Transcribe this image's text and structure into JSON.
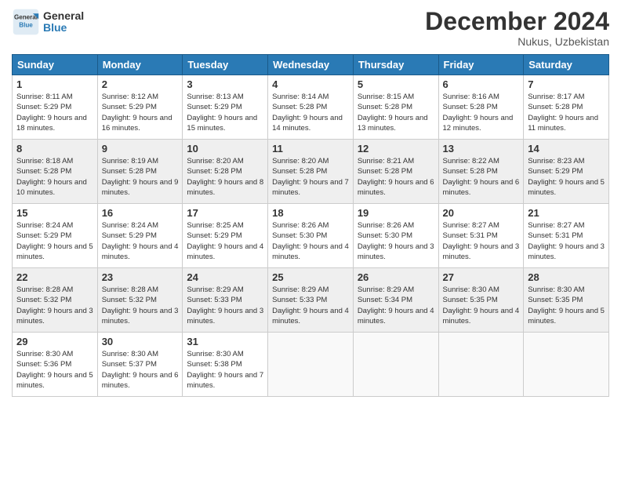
{
  "logo": {
    "general": "General",
    "blue": "Blue"
  },
  "title": "December 2024",
  "subtitle": "Nukus, Uzbekistan",
  "headers": [
    "Sunday",
    "Monday",
    "Tuesday",
    "Wednesday",
    "Thursday",
    "Friday",
    "Saturday"
  ],
  "weeks": [
    [
      {
        "day": "1",
        "sunrise": "8:11 AM",
        "sunset": "5:29 PM",
        "daylight": "9 hours and 18 minutes."
      },
      {
        "day": "2",
        "sunrise": "8:12 AM",
        "sunset": "5:29 PM",
        "daylight": "9 hours and 16 minutes."
      },
      {
        "day": "3",
        "sunrise": "8:13 AM",
        "sunset": "5:29 PM",
        "daylight": "9 hours and 15 minutes."
      },
      {
        "day": "4",
        "sunrise": "8:14 AM",
        "sunset": "5:28 PM",
        "daylight": "9 hours and 14 minutes."
      },
      {
        "day": "5",
        "sunrise": "8:15 AM",
        "sunset": "5:28 PM",
        "daylight": "9 hours and 13 minutes."
      },
      {
        "day": "6",
        "sunrise": "8:16 AM",
        "sunset": "5:28 PM",
        "daylight": "9 hours and 12 minutes."
      },
      {
        "day": "7",
        "sunrise": "8:17 AM",
        "sunset": "5:28 PM",
        "daylight": "9 hours and 11 minutes."
      }
    ],
    [
      {
        "day": "8",
        "sunrise": "8:18 AM",
        "sunset": "5:28 PM",
        "daylight": "9 hours and 10 minutes."
      },
      {
        "day": "9",
        "sunrise": "8:19 AM",
        "sunset": "5:28 PM",
        "daylight": "9 hours and 9 minutes."
      },
      {
        "day": "10",
        "sunrise": "8:20 AM",
        "sunset": "5:28 PM",
        "daylight": "9 hours and 8 minutes."
      },
      {
        "day": "11",
        "sunrise": "8:20 AM",
        "sunset": "5:28 PM",
        "daylight": "9 hours and 7 minutes."
      },
      {
        "day": "12",
        "sunrise": "8:21 AM",
        "sunset": "5:28 PM",
        "daylight": "9 hours and 6 minutes."
      },
      {
        "day": "13",
        "sunrise": "8:22 AM",
        "sunset": "5:28 PM",
        "daylight": "9 hours and 6 minutes."
      },
      {
        "day": "14",
        "sunrise": "8:23 AM",
        "sunset": "5:29 PM",
        "daylight": "9 hours and 5 minutes."
      }
    ],
    [
      {
        "day": "15",
        "sunrise": "8:24 AM",
        "sunset": "5:29 PM",
        "daylight": "9 hours and 5 minutes."
      },
      {
        "day": "16",
        "sunrise": "8:24 AM",
        "sunset": "5:29 PM",
        "daylight": "9 hours and 4 minutes."
      },
      {
        "day": "17",
        "sunrise": "8:25 AM",
        "sunset": "5:29 PM",
        "daylight": "9 hours and 4 minutes."
      },
      {
        "day": "18",
        "sunrise": "8:26 AM",
        "sunset": "5:30 PM",
        "daylight": "9 hours and 4 minutes."
      },
      {
        "day": "19",
        "sunrise": "8:26 AM",
        "sunset": "5:30 PM",
        "daylight": "9 hours and 3 minutes."
      },
      {
        "day": "20",
        "sunrise": "8:27 AM",
        "sunset": "5:31 PM",
        "daylight": "9 hours and 3 minutes."
      },
      {
        "day": "21",
        "sunrise": "8:27 AM",
        "sunset": "5:31 PM",
        "daylight": "9 hours and 3 minutes."
      }
    ],
    [
      {
        "day": "22",
        "sunrise": "8:28 AM",
        "sunset": "5:32 PM",
        "daylight": "9 hours and 3 minutes."
      },
      {
        "day": "23",
        "sunrise": "8:28 AM",
        "sunset": "5:32 PM",
        "daylight": "9 hours and 3 minutes."
      },
      {
        "day": "24",
        "sunrise": "8:29 AM",
        "sunset": "5:33 PM",
        "daylight": "9 hours and 3 minutes."
      },
      {
        "day": "25",
        "sunrise": "8:29 AM",
        "sunset": "5:33 PM",
        "daylight": "9 hours and 4 minutes."
      },
      {
        "day": "26",
        "sunrise": "8:29 AM",
        "sunset": "5:34 PM",
        "daylight": "9 hours and 4 minutes."
      },
      {
        "day": "27",
        "sunrise": "8:30 AM",
        "sunset": "5:35 PM",
        "daylight": "9 hours and 4 minutes."
      },
      {
        "day": "28",
        "sunrise": "8:30 AM",
        "sunset": "5:35 PM",
        "daylight": "9 hours and 5 minutes."
      }
    ],
    [
      {
        "day": "29",
        "sunrise": "8:30 AM",
        "sunset": "5:36 PM",
        "daylight": "9 hours and 5 minutes."
      },
      {
        "day": "30",
        "sunrise": "8:30 AM",
        "sunset": "5:37 PM",
        "daylight": "9 hours and 6 minutes."
      },
      {
        "day": "31",
        "sunrise": "8:30 AM",
        "sunset": "5:38 PM",
        "daylight": "9 hours and 7 minutes."
      },
      null,
      null,
      null,
      null
    ]
  ]
}
